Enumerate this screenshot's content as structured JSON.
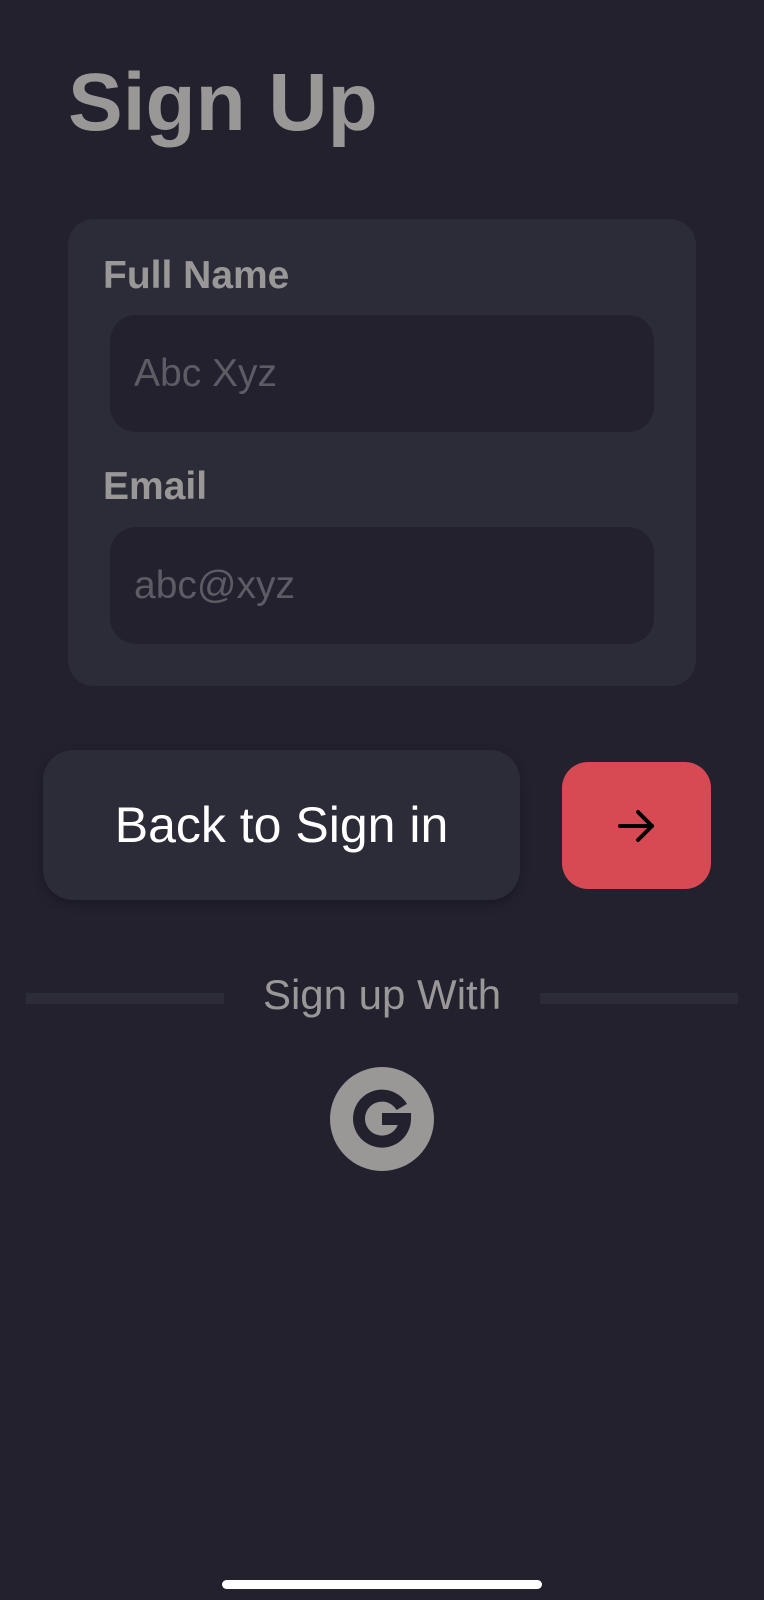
{
  "page": {
    "title": "Sign Up"
  },
  "form": {
    "full_name": {
      "label": "Full Name",
      "value": "",
      "placeholder": "Abc Xyz"
    },
    "email": {
      "label": "Email",
      "value": "",
      "placeholder": "abc@xyz"
    }
  },
  "actions": {
    "back_label": "Back to Sign in",
    "next_icon": "arrow-right-icon"
  },
  "social": {
    "divider_text": "Sign up With",
    "providers": [
      {
        "name": "google",
        "icon": "google-icon"
      }
    ]
  },
  "colors": {
    "background": "#22212d",
    "card": "#2c2b38",
    "accent": "#d84a53",
    "muted_text": "#9a9797",
    "button_text": "#ffffff"
  }
}
